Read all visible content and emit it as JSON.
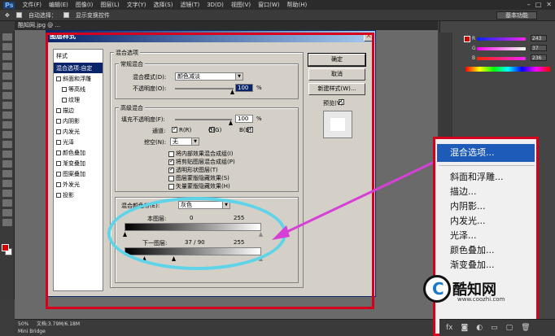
{
  "menubar": {
    "logo": "Ps",
    "items": [
      "文件(F)",
      "编辑(E)",
      "图像(I)",
      "图层(L)",
      "文字(Y)",
      "选择(S)",
      "滤镜(T)",
      "3D(D)",
      "视图(V)",
      "窗口(W)",
      "帮助(H)"
    ]
  },
  "optionbar": {
    "auto_select": "自动选择：",
    "show_transform": "显示变换控件"
  },
  "workspace": "基本功能",
  "doc_tab": "酷知网.jpg @ ...",
  "status": {
    "zoom": "50%",
    "doc": "文档:3.79M/6.18M",
    "minibridge": "Mini Bridge"
  },
  "color_panel": {
    "r": "243",
    "g": "37",
    "b": "236"
  },
  "dialog": {
    "title": "图层样式",
    "styles_header": "样式",
    "style_items": [
      {
        "label": "混合选项:自定",
        "selected": true,
        "check": false
      },
      {
        "label": "斜面和浮雕",
        "check": true
      },
      {
        "label": "等高线",
        "check": true,
        "sub": true
      },
      {
        "label": "纹理",
        "check": true,
        "sub": true
      },
      {
        "label": "描边",
        "check": true
      },
      {
        "label": "内阴影",
        "check": true
      },
      {
        "label": "内发光",
        "check": true
      },
      {
        "label": "光泽",
        "check": true
      },
      {
        "label": "颜色叠加",
        "check": true
      },
      {
        "label": "渐变叠加",
        "check": true
      },
      {
        "label": "图案叠加",
        "check": true
      },
      {
        "label": "外发光",
        "check": true
      },
      {
        "label": "投影",
        "check": true
      }
    ],
    "blend_options_title": "混合选项",
    "normal_blend_title": "常规混合",
    "blend_mode_label": "混合模式(D):",
    "blend_mode_value": "颜色减淡",
    "opacity_label": "不透明度(O):",
    "opacity_value": "100",
    "percent": "%",
    "advanced_title": "高级混合",
    "fill_opacity_label": "填充不透明度(F):",
    "fill_opacity_value": "100",
    "channels_label": "通道:",
    "channel_r": "R(R)",
    "channel_g": "G(G)",
    "channel_b": "B(B)",
    "knockout_label": "挖空(N):",
    "knockout_value": "无",
    "options": [
      {
        "label": "将内部效果混合成组(I)",
        "checked": false
      },
      {
        "label": "将剪贴图层混合成组(P)",
        "checked": true
      },
      {
        "label": "透明形状图层(T)",
        "checked": true
      },
      {
        "label": "图层蒙版隐藏效果(S)",
        "checked": false
      },
      {
        "label": "矢量蒙版隐藏效果(H)",
        "checked": false
      }
    ],
    "blend_if_label": "混合颜色带(E):",
    "blend_if_value": "灰色",
    "this_layer_label": "本图层:",
    "this_layer_min": "0",
    "this_layer_max": "255",
    "underlying_label": "下一图层:",
    "underlying_value": "37 / 90",
    "underlying_max": "255",
    "btn_ok": "确定",
    "btn_cancel": "取消",
    "btn_new_style": "新建样式(W)...",
    "preview_label": "预览(V)"
  },
  "popup_menu": {
    "items": [
      "混合选项...",
      "斜面和浮雕...",
      "描边...",
      "内阴影...",
      "内发光...",
      "光泽...",
      "颜色叠加...",
      "渐变叠加..."
    ]
  },
  "watermark": {
    "name": "酷知网",
    "url": "www.coozhi.com"
  },
  "colors": {
    "annotation_red": "#d6001c",
    "ellipse_cyan": "#5fd4e8",
    "arrow_magenta": "#d640d6",
    "menu_highlight": "#1e5bb8"
  }
}
